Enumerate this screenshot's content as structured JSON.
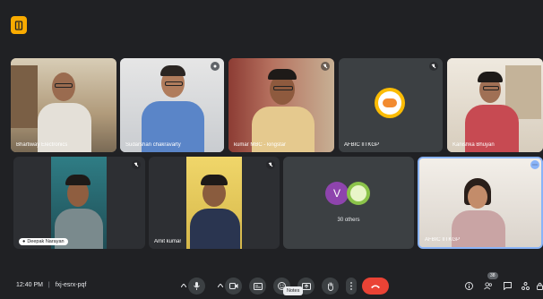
{
  "colors": {
    "accent": "#8ab4f8",
    "endcall": "#ea4335",
    "badge": "#f9ab00"
  },
  "participants": [
    {
      "name": "Bhartiway Electronics"
    },
    {
      "name": "Sudarshan chakravarty"
    },
    {
      "name": "kumar MBC - kingstar"
    },
    {
      "name": "AFBIC IITKGP"
    },
    {
      "name": "Kanishka Bhuyan"
    },
    {
      "name": "Deepak Narayan"
    },
    {
      "name": "Amit kumar"
    },
    {
      "name": "AFBIC IITKGP"
    }
  ],
  "others": {
    "label": "30 others",
    "avatar_letter": "V"
  },
  "meeting": {
    "time": "12:40 PM",
    "separator": "|",
    "code": "fxj-esrx-pqf"
  },
  "tooltip": "Notes",
  "people_count": "38"
}
